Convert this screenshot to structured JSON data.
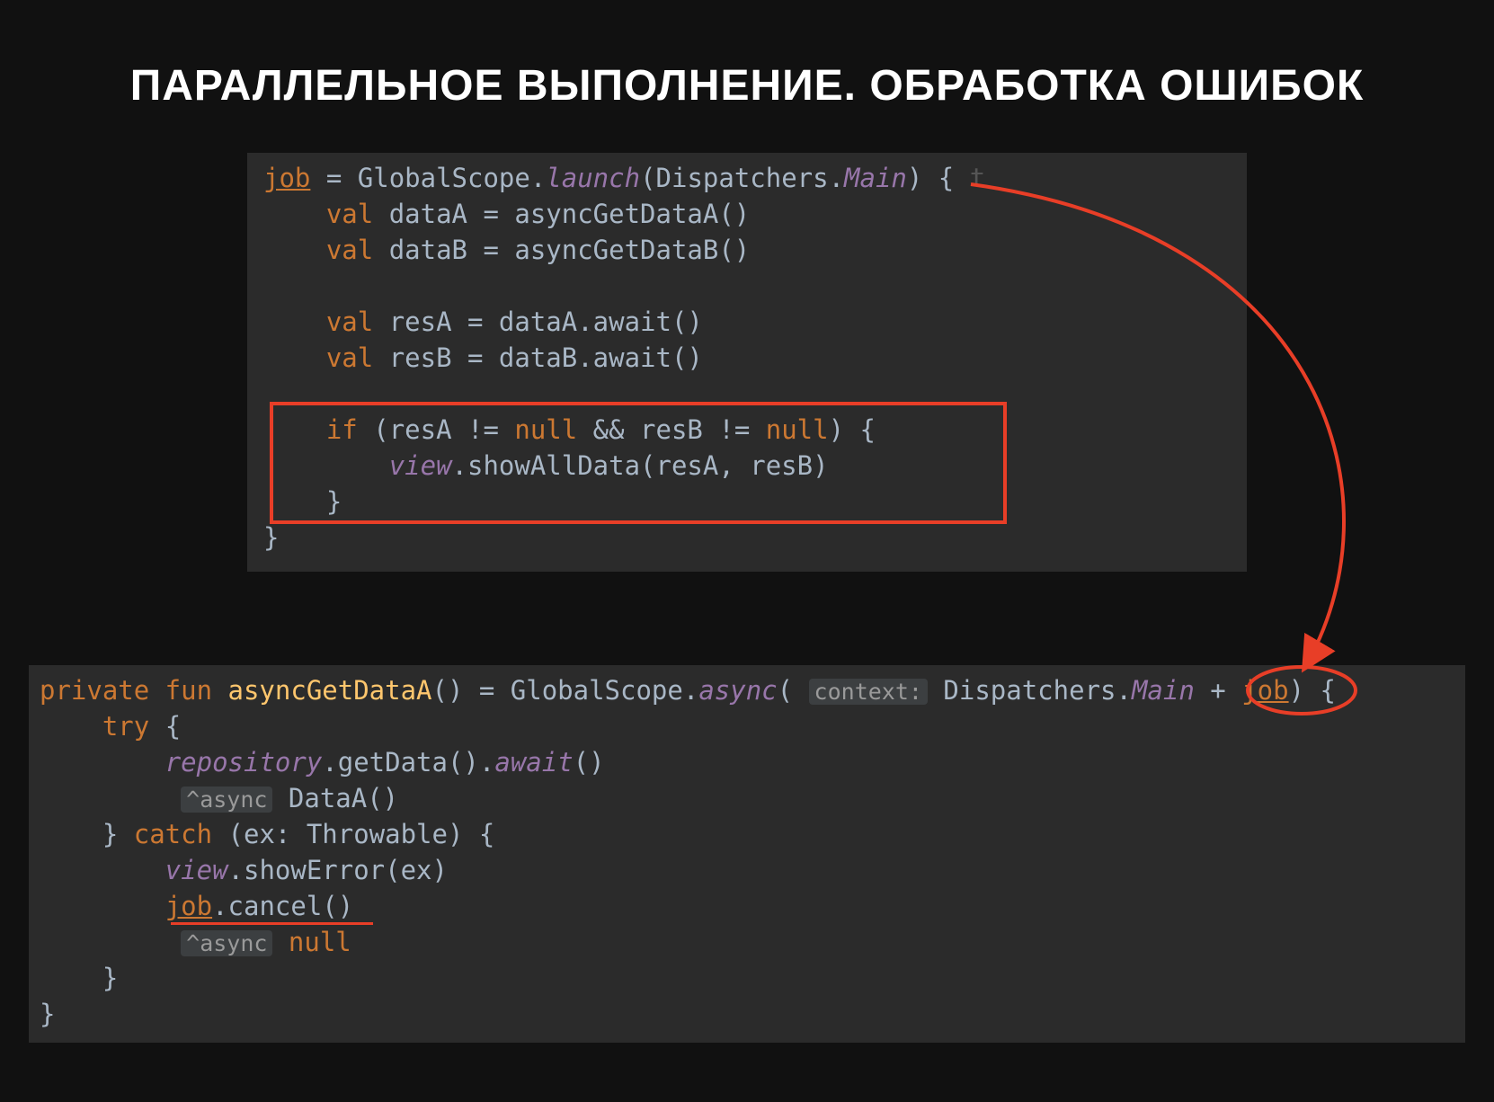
{
  "title": "ПАРАЛЛЕЛЬНОЕ ВЫПОЛНЕНИЕ. ОБРАБОТКА ОШИБОК",
  "code1": {
    "l1": {
      "job": "job",
      "eq": " = GlobalScope.",
      "launch": "launch",
      "open": "(Dispatchers.",
      "main": "Main",
      "close": ") { ",
      "trail": "t"
    },
    "l2": {
      "indent": "    ",
      "kw": "val",
      "rest": " dataA = asyncGetDataA()"
    },
    "l3": {
      "indent": "    ",
      "kw": "val",
      "rest": " dataB = asyncGetDataB()"
    },
    "l4": "",
    "l5": {
      "indent": "    ",
      "kw": "val",
      "rest": " resA = dataA.await()"
    },
    "l6": {
      "indent": "    ",
      "kw": "val",
      "rest": " resB = dataB.await()"
    },
    "l7": "",
    "l8": {
      "indent": "    ",
      "kw": "if ",
      "open": "(resA != ",
      "n1": "null",
      "mid": " && resB != ",
      "n2": "null",
      "close": ") {"
    },
    "l9": {
      "indent": "        ",
      "view": "view",
      "call": ".showAllData(resA, resB)"
    },
    "l10": "    }",
    "l11": "}"
  },
  "code2": {
    "l1": {
      "pre": "private fun ",
      "fn": "asyncGetDataA",
      "p1": "() = GlobalScope.",
      "async": "async",
      "open": "( ",
      "hint": "context:",
      "p2": " Dispatchers.",
      "main": "Main ",
      "plus": "+ ",
      "job": "job",
      "close": ") {"
    },
    "l2": {
      "indent": "    ",
      "kw": "try",
      "brace": " {"
    },
    "l3": {
      "indent": "        ",
      "rep": "repository",
      "call": ".getData().",
      "await": "await",
      "paren": "()"
    },
    "l4": {
      "indent": "         ",
      "hintlabel": "^async",
      "rest": " DataA()"
    },
    "l5": {
      "indent": "    } ",
      "kw": "catch",
      "rest": " (ex: Throwable) {"
    },
    "l6": {
      "indent": "        ",
      "view": "view",
      "call": ".showError(ex)"
    },
    "l7": {
      "indent": "        ",
      "job": "job",
      "call": ".cancel()"
    },
    "l8": {
      "indent": "         ",
      "hintlabel": "^async",
      "sp": " ",
      "null": "null"
    },
    "l9": "    }",
    "l10": "}"
  },
  "colors": {
    "accent_red": "#e83e27",
    "bg_code": "#2b2b2b",
    "keyword": "#cc7832",
    "function": "#ffc66d",
    "italic": "#9876aa",
    "text": "#a9b7c6"
  }
}
